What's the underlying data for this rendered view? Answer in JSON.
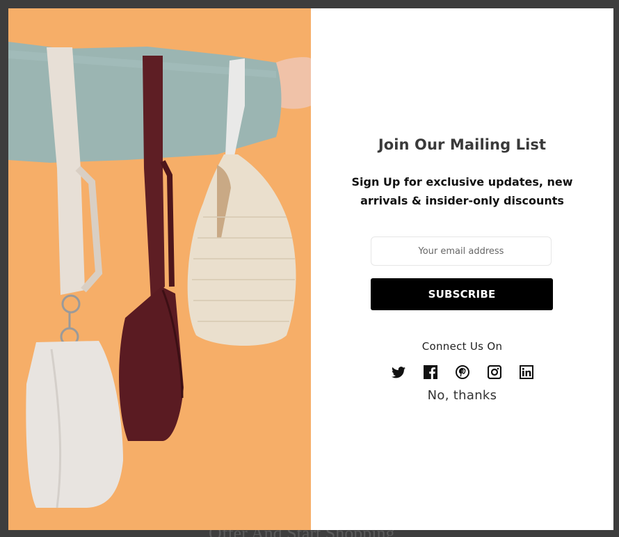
{
  "background": {
    "footer_text": "Offer And Start Shopping"
  },
  "modal": {
    "image_alt": "Arm in a mint sweater holding three handbags against an orange background",
    "heading": "Join Our Mailing List",
    "subheading": "Sign Up for exclusive updates, new arrivals & insider-only discounts",
    "email_placeholder": "Your email address",
    "email_value": "",
    "subscribe_label": "SUBSCRIBE",
    "connect_label": "Connect Us On",
    "social": [
      {
        "name": "twitter-icon"
      },
      {
        "name": "facebook-icon"
      },
      {
        "name": "pinterest-icon"
      },
      {
        "name": "instagram-icon"
      },
      {
        "name": "linkedin-icon"
      }
    ],
    "dismiss_label": "No, thanks"
  },
  "colors": {
    "image_background": "#f6ae68",
    "button_background": "#000000",
    "button_text": "#ffffff",
    "overlay": "#3d3d3d"
  }
}
